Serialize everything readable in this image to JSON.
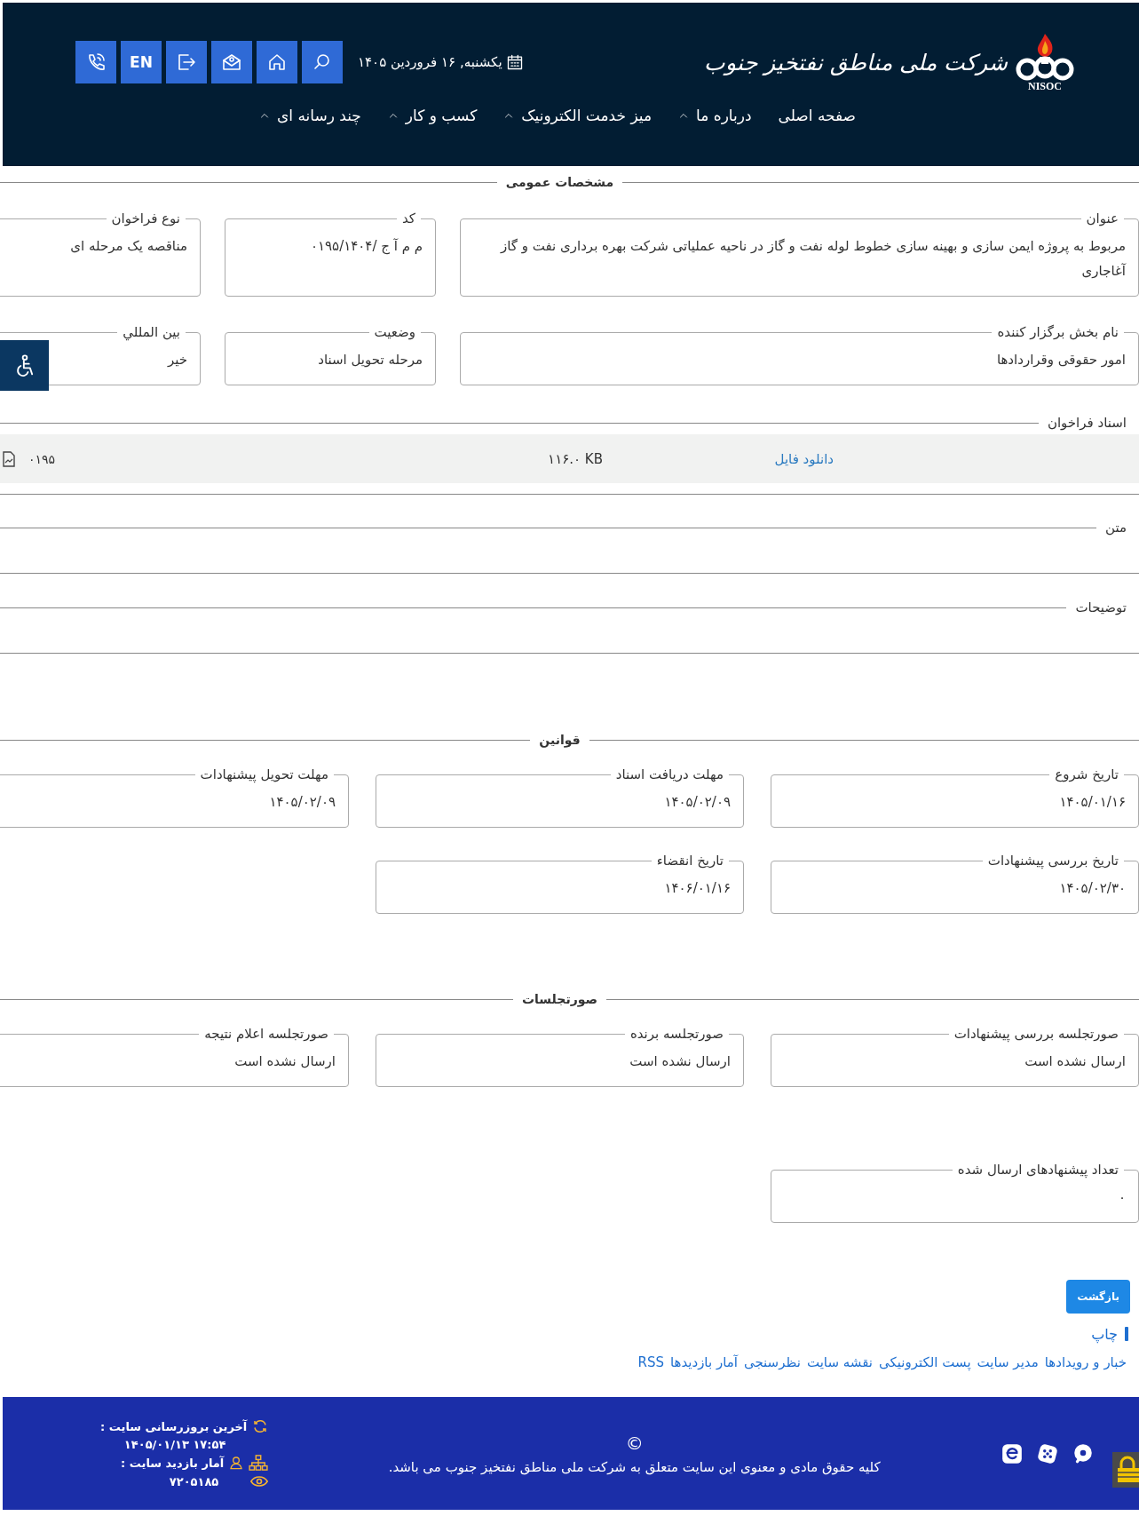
{
  "header": {
    "logo": {
      "name": "شرکت ملی مناطق نفتخیز جنوب",
      "abbr": "NISOC"
    },
    "date": "یکشنبه, ۱۶ فروردین ۱۴۰۵",
    "tools": [
      {
        "kind": "search"
      },
      {
        "kind": "home"
      },
      {
        "kind": "mail"
      },
      {
        "kind": "logout"
      },
      {
        "kind": "lang",
        "label": "EN"
      },
      {
        "kind": "phone"
      }
    ],
    "nav": [
      {
        "label": "صفحه اصلی",
        "dropdown": false
      },
      {
        "label": "درباره ما",
        "dropdown": true
      },
      {
        "label": "میز خدمت الکترونیک",
        "dropdown": true
      },
      {
        "label": "کسب و کار",
        "dropdown": true
      },
      {
        "label": "چند رسانه ای",
        "dropdown": true
      }
    ]
  },
  "sections": [
    {
      "kind": "fields",
      "title": "مشخصات عمومی",
      "fields": [
        {
          "label": "عنوان",
          "value": "مربوط به پروژه ایمن سازی و بهینه سازی خطوط لوله نفت و گاز در ناحیه عملیاتی شرکت بهره برداری نفت و گاز آغاجاری"
        },
        {
          "label": "کد",
          "value": "م م آ ج /۰۱۹۵/۱۴۰۴"
        },
        {
          "label": "نوع فراخوان",
          "value": "مناقصه یک مرحله ای"
        },
        {
          "label": "نام بخش برگزار کننده",
          "value": "امور حقوقی وقراردادها"
        },
        {
          "label": "وضعیت",
          "value": "مرحله تحویل اسناد"
        },
        {
          "label": "بین المللي",
          "value": "خیر"
        }
      ]
    },
    {
      "kind": "files",
      "title": "اسناد فراخوان",
      "files": [
        {
          "link": "دانلود فایل",
          "size": "۱۱۶.۰ KB",
          "name": "۰۱۹۵"
        }
      ]
    },
    {
      "kind": "text",
      "title": "متن"
    },
    {
      "kind": "text",
      "title": "توضیحات"
    },
    {
      "kind": "fields",
      "title": "قوانین",
      "fields": [
        {
          "label": "تاریخ شروع",
          "value": "۱۴۰۵/۰۱/۱۶"
        },
        {
          "label": "مهلت دریافت اسناد",
          "value": "۱۴۰۵/۰۲/۰۹"
        },
        {
          "label": "مهلت تحویل پیشنهادات",
          "value": "۱۴۰۵/۰۲/۰۹"
        },
        {
          "label": "تاریخ بررسی پیشنهادات",
          "value": "۱۴۰۵/۰۲/۳۰"
        },
        {
          "label": "تاریخ انقضاء",
          "value": "۱۴۰۶/۰۱/۱۶"
        }
      ]
    },
    {
      "kind": "fields",
      "title": "صورتجلسات",
      "fields": [
        {
          "label": "صورتجلسه بررسی پیشنهادات",
          "value": "ارسال نشده است"
        },
        {
          "label": "صورتجلسه برنده",
          "value": "ارسال نشده است"
        },
        {
          "label": "صورتجلسه اعلام نتیجه",
          "value": "ارسال نشده است"
        }
      ]
    },
    {
      "kind": "fields",
      "fields": [
        {
          "label": "تعداد پیشنهادهای ارسال شده",
          "value": "۰"
        }
      ]
    }
  ],
  "actions": {
    "back": "بازگشت",
    "print": "چاپ"
  },
  "links": [
    "خبار و رویدادها",
    "مدیر سایت",
    "پست الکترونیکی",
    "نقشه سایت",
    "نظرسنجی",
    "آمار بازدیدها",
    "RSS"
  ],
  "footer": {
    "social": [
      {
        "kind": "chat"
      },
      {
        "kind": "dice"
      },
      {
        "kind": "e"
      }
    ],
    "copyright_symbol": "©",
    "copyright": "کلیه حقوق مادی و معنوی این سایت متعلق به شرکت ملی مناطق نفتخیز جنوب می باشد.",
    "updated_label": "آخرین بروزرسانی سایت :",
    "updated_value": "۱۷:۵۴ ۱۴۰۵/۰۱/۱۳",
    "visits_label": "آمار بازدید سایت :",
    "visits_value": "۷۲۰۵۱۸۵"
  }
}
